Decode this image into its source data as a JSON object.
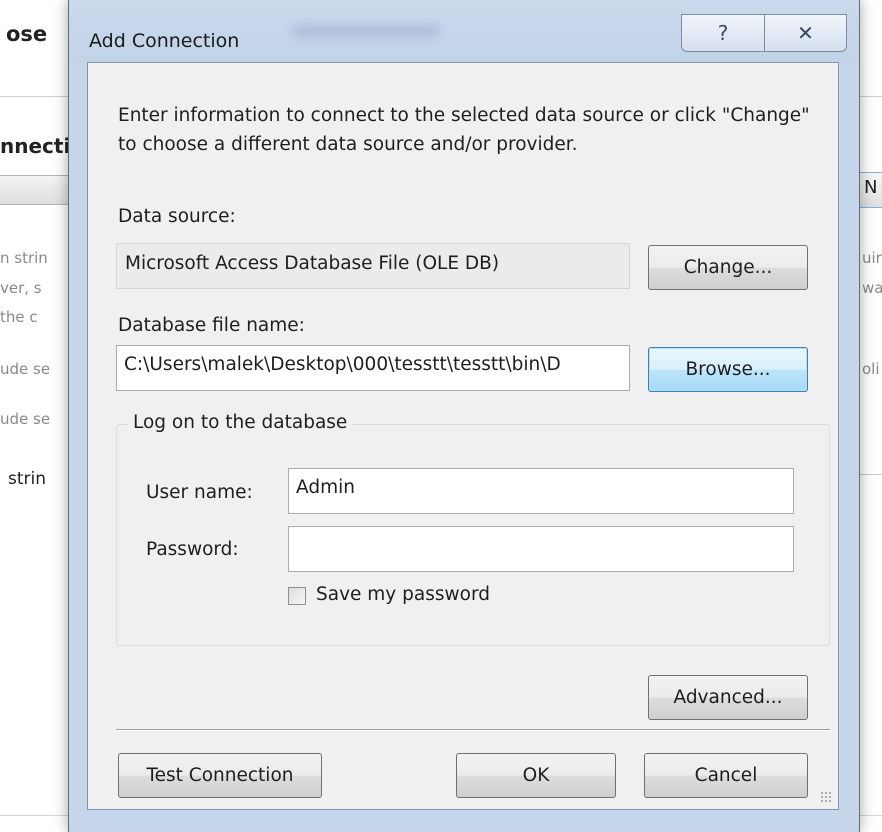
{
  "background": {
    "title": "ose",
    "section": "nnecti",
    "new_button": "N",
    "lines_left": [
      "n strin",
      "ver, s",
      "the c"
    ],
    "lines_right": [
      "uire",
      "wa"
    ],
    "checkbox_texts": [
      "ude se",
      "ude se"
    ],
    "right_text": "oli",
    "string_label": "strin"
  },
  "dialog": {
    "title": "Add Connection",
    "help_glyph": "?",
    "close_glyph": "✕",
    "intro": "Enter information to connect to the selected data source or click \"Change\" to choose a different data source and/or provider.",
    "data_source_label": "Data source:",
    "data_source_value": "Microsoft Access Database File (OLE DB)",
    "change_button": "Change...",
    "db_file_label": "Database file name:",
    "db_file_value": "C:\\Users\\malek\\Desktop\\000\\tesstt\\tesstt\\bin\\D",
    "browse_button": "Browse...",
    "logon_group": "Log on to the database",
    "username_label": "User name:",
    "username_value": "Admin",
    "password_label": "Password:",
    "password_value": "",
    "save_password_label": "Save my password",
    "save_password_checked": false,
    "advanced_button": "Advanced...",
    "test_button": "Test Connection",
    "ok_button": "OK",
    "cancel_button": "Cancel"
  }
}
